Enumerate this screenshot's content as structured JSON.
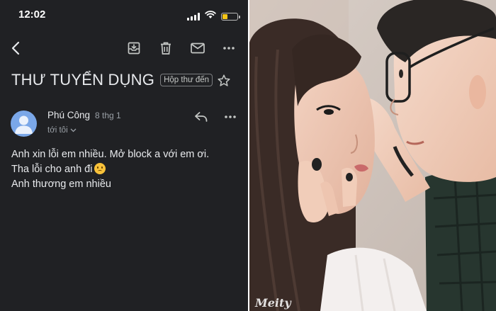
{
  "status_bar": {
    "time": "12:02",
    "battery_level": 0.3,
    "battery_color": "#f5c518"
  },
  "toolbar": {
    "icons": [
      "back-arrow-icon",
      "archive-icon",
      "trash-icon",
      "mail-icon",
      "more-horizontal-icon"
    ]
  },
  "email": {
    "subject": "THƯ TUYỂN DỤNG",
    "label": "Hộp thư đến",
    "sender_name": "Phú Công",
    "date": "8 thg 1",
    "recipient_line": "tới tôi",
    "body_lines": [
      "Anh xin lỗi em nhiều. Mở block a với em ơi.",
      "Tha lỗi cho anh đi",
      "Anh thương em nhiều"
    ],
    "emoji": "confused-face-emoji"
  },
  "photo": {
    "watermark": "Meity",
    "description_icon": "couple-photo"
  },
  "colors": {
    "background": "#202124",
    "text_primary": "#e8eaed",
    "text_secondary": "#9aa0a6",
    "avatar": "#7aa7e8"
  }
}
